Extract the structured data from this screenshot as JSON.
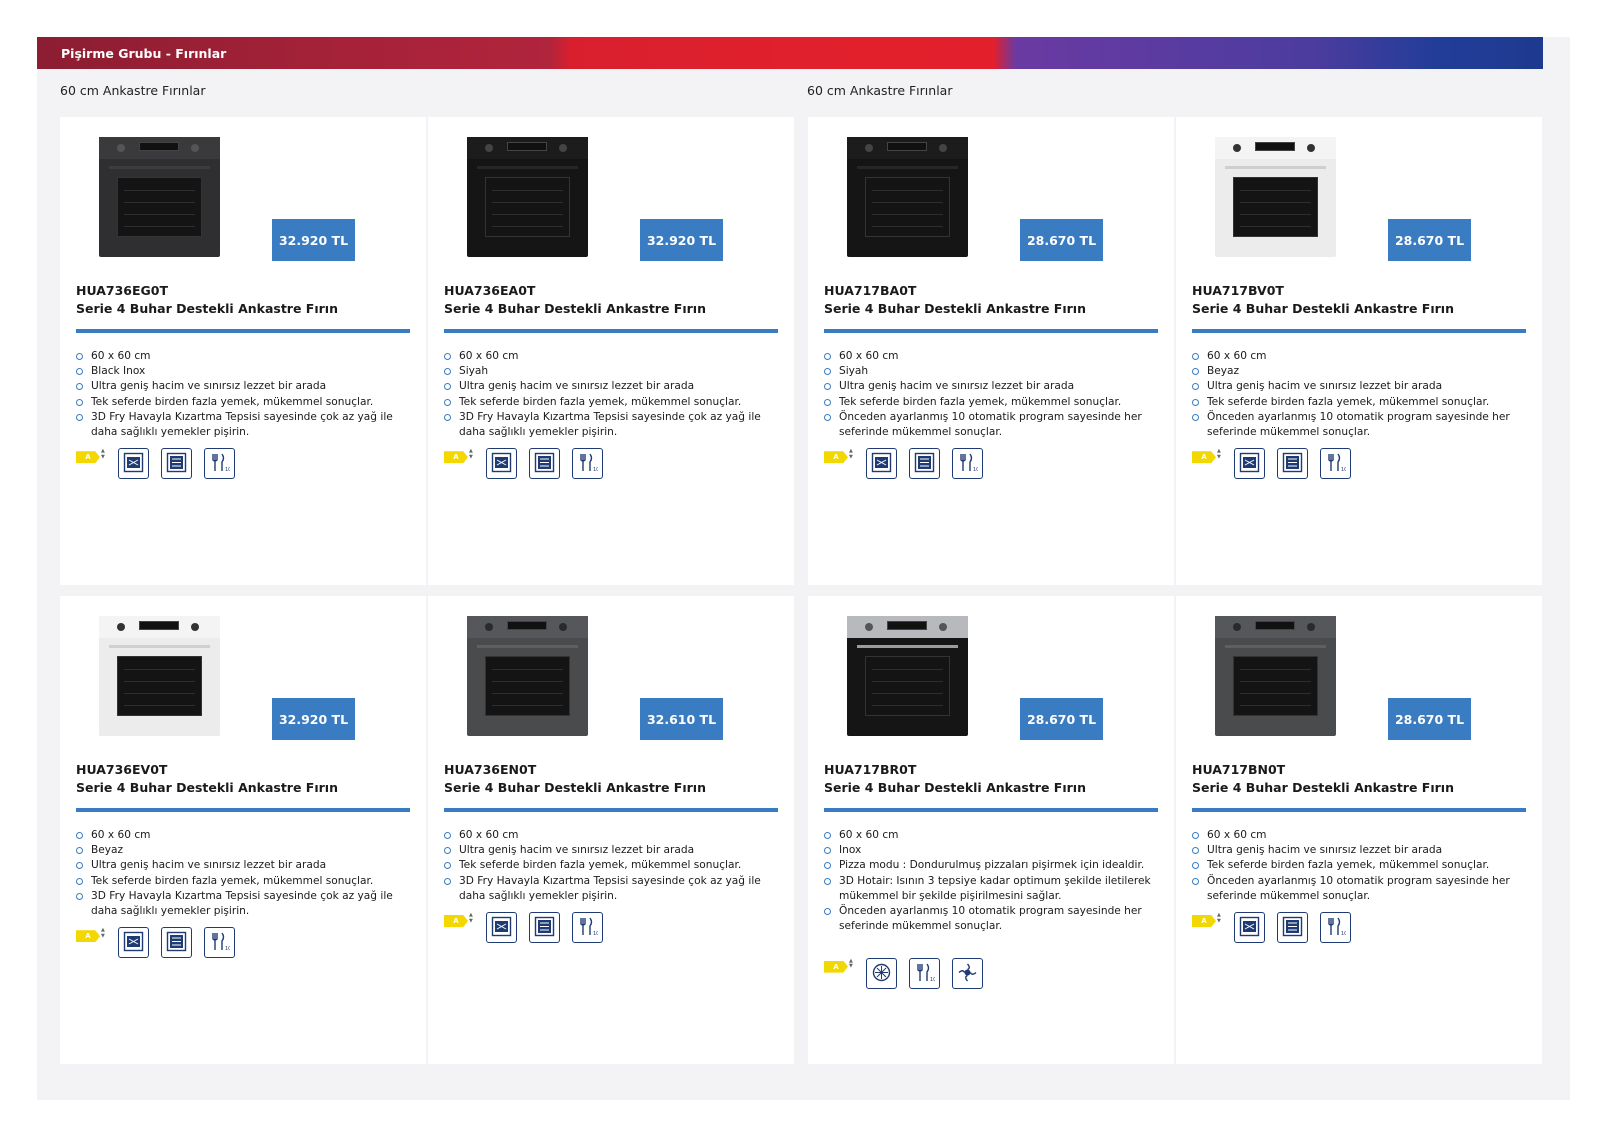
{
  "header": {
    "title": "Pişirme Grubu - Fırınlar"
  },
  "sections": [
    {
      "label": "60 cm Ankastre Fırınlar"
    },
    {
      "label": "60 cm Ankastre Fırınlar"
    }
  ],
  "colors": {
    "accent": "#3a7cc1",
    "energy": "#f2d700",
    "icon_stroke": "#1f3b73"
  },
  "products": [
    {
      "model": "HUA736EG0T",
      "name": "Serie 4 Buhar Destekli Ankastre Fırın",
      "price": "32.920 TL",
      "finish": "dark",
      "features": [
        "60 x 60 cm",
        "Black Inox",
        "Ultra geniş hacim ve sınırsız lezzet bir arada",
        "Tek seferde birden fazla yemek, mükemmel sonuçlar.",
        "3D Fry Havayla Kızartma Tepsisi sayesinde çok az yağ ile daha sağlıklı yemekler pişirin."
      ],
      "energy": "A",
      "icons": [
        "air-fry-icon",
        "multi-level-icon",
        "autopilot-10-icon"
      ]
    },
    {
      "model": "HUA736EA0T",
      "name": "Serie 4 Buhar Destekli Ankastre Fırın",
      "price": "32.920 TL",
      "finish": "black",
      "features": [
        "60 x 60 cm",
        "Siyah",
        "Ultra geniş hacim ve sınırsız lezzet bir arada",
        "Tek seferde birden fazla yemek, mükemmel sonuçlar.",
        "3D Fry Havayla Kızartma Tepsisi sayesinde çok az yağ ile daha sağlıklı yemekler pişirin."
      ],
      "energy": "A",
      "icons": [
        "air-fry-icon",
        "multi-level-icon",
        "autopilot-10-icon"
      ]
    },
    {
      "model": "HUA717BA0T",
      "name": "Serie 4 Buhar Destekli Ankastre Fırın",
      "price": "28.670 TL",
      "finish": "black",
      "features": [
        "60 x 60 cm",
        "Siyah",
        "Ultra geniş hacim ve sınırsız lezzet bir arada",
        "Tek seferde birden fazla yemek, mükemmel sonuçlar.",
        "Önceden ayarlanmış 10 otomatik program sayesinde her seferinde mükemmel sonuçlar."
      ],
      "energy": "A",
      "icons": [
        "air-fry-icon",
        "multi-level-icon",
        "autopilot-10-icon"
      ]
    },
    {
      "model": "HUA717BV0T",
      "name": "Serie 4 Buhar Destekli Ankastre Fırın",
      "price": "28.670 TL",
      "finish": "white",
      "features": [
        "60 x 60 cm",
        "Beyaz",
        "Ultra geniş hacim ve sınırsız lezzet bir arada",
        "Tek seferde birden fazla yemek, mükemmel sonuçlar.",
        "Önceden ayarlanmış 10 otomatik program sayesinde her seferinde mükemmel sonuçlar."
      ],
      "energy": "A",
      "icons": [
        "air-fry-icon",
        "multi-level-icon",
        "autopilot-10-icon"
      ]
    },
    {
      "model": "HUA736EV0T",
      "name": "Serie 4 Buhar Destekli Ankastre Fırın",
      "price": "32.920 TL",
      "finish": "white",
      "features": [
        "60 x 60 cm",
        "Beyaz",
        "Ultra geniş hacim ve sınırsız lezzet bir arada",
        "Tek seferde birden fazla yemek, mükemmel sonuçlar.",
        "3D Fry Havayla Kızartma Tepsisi sayesinde çok az yağ ile daha sağlıklı yemekler pişirin."
      ],
      "energy": "A",
      "icons": [
        "air-fry-icon",
        "multi-level-icon",
        "autopilot-10-icon"
      ]
    },
    {
      "model": "HUA736EN0T",
      "name": "Serie 4 Buhar Destekli Ankastre Fırın",
      "price": "32.610 TL",
      "finish": "grey",
      "features": [
        "60 x 60 cm",
        "Ultra geniş hacim ve sınırsız lezzet bir arada",
        "Tek seferde birden fazla yemek, mükemmel sonuçlar.",
        "3D Fry Havayla Kızartma Tepsisi sayesinde çok az yağ ile daha sağlıklı yemekler pişirin."
      ],
      "energy": "A",
      "icons": [
        "air-fry-icon",
        "multi-level-icon",
        "autopilot-10-icon"
      ]
    },
    {
      "model": "HUA717BR0T",
      "name": "Serie 4 Buhar Destekli Ankastre Fırın",
      "price": "28.670 TL",
      "finish": "inox",
      "features": [
        "60 x 60 cm",
        "Inox",
        "Pizza modu : Dondurulmuş pizzaları pişirmek için idealdir.",
        "3D Hotair: Isının 3 tepsiye kadar optimum şekilde iletilerek mükemmel bir şekilde pişirilmesini sağlar.",
        "Önceden ayarlanmış 10 otomatik program sayesinde her seferinde mükemmel sonuçlar."
      ],
      "energy": "A",
      "icons": [
        "3d-hotair-icon",
        "autopilot-10-icon",
        "pizza-mode-icon"
      ]
    },
    {
      "model": "HUA717BN0T",
      "name": "Serie 4 Buhar Destekli Ankastre Fırın",
      "price": "28.670 TL",
      "finish": "grey",
      "features": [
        "60 x 60 cm",
        "Ultra geniş hacim ve sınırsız lezzet bir arada",
        "Tek seferde birden fazla yemek, mükemmel sonuçlar.",
        "Önceden ayarlanmış 10 otomatik program sayesinde her seferinde mükemmel sonuçlar."
      ],
      "energy": "A",
      "icons": [
        "air-fry-icon",
        "multi-level-icon",
        "autopilot-10-icon"
      ]
    }
  ]
}
